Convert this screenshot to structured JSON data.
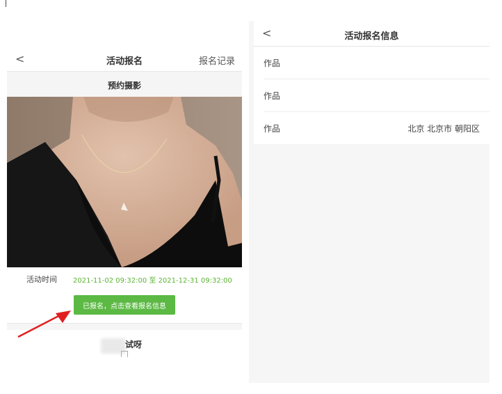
{
  "left": {
    "nav": {
      "back_glyph": "<",
      "title": "活动报名",
      "records_link": "报名记录"
    },
    "section_title": "预约摄影",
    "activity_time": {
      "label": "活动时间",
      "value": "2021-11-02 09:32:00 至 2021-12-31 09:32:00"
    },
    "signed_button": "已报名，点击查看报名信息",
    "participant_name": "试呀"
  },
  "right": {
    "nav": {
      "back_glyph": "<",
      "title": "活动报名信息"
    },
    "rows": [
      {
        "label": "作品",
        "value": ""
      },
      {
        "label": "作品",
        "value": ""
      },
      {
        "label": "作品",
        "value": "北京 北京市 朝阳区"
      }
    ]
  },
  "colors": {
    "accent_green": "#5cb944",
    "time_green": "#5ab431",
    "arrow_red": "#e02020"
  },
  "icons": [
    "back-arrow-icon",
    "red-pointer-arrow-icon"
  ]
}
